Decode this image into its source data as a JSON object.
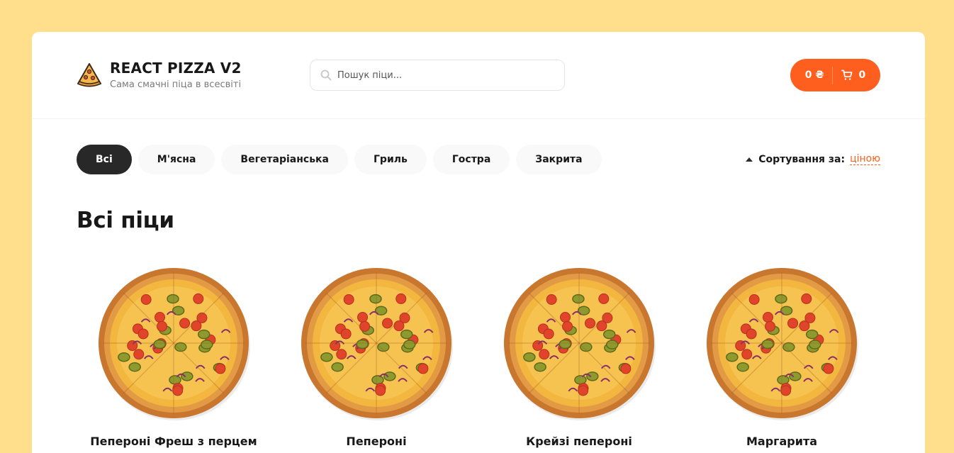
{
  "header": {
    "logo_title": "REACT PIZZA V2",
    "logo_subtitle": "Сама смачні піца в всесвіті",
    "search_placeholder": "Пошук піци...",
    "cart_price": "0 ₴",
    "cart_count": "0"
  },
  "categories": [
    "Всі",
    "М'ясна",
    "Вегетаріанська",
    "Гриль",
    "Гостра",
    "Закрита"
  ],
  "active_category": "Всі",
  "sort": {
    "label": "Сортування за:",
    "value": "ціною"
  },
  "content_title": "Всі піци",
  "pizzas": [
    {
      "name": "Пепероні Фреш з перцем"
    },
    {
      "name": "Пепероні"
    },
    {
      "name": "Крейзі пепероні"
    },
    {
      "name": "Маргарита"
    }
  ],
  "colors": {
    "accent": "#FE5F1E",
    "background": "#FFDF8C",
    "active_category": "#282828"
  }
}
